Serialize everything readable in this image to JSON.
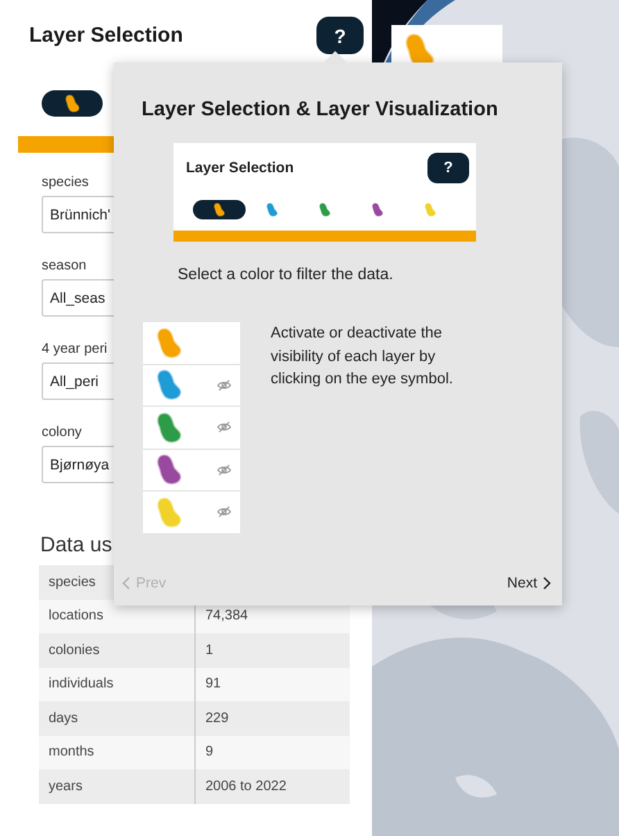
{
  "panel": {
    "title": "Layer Selection",
    "help": "?",
    "chips": [
      {
        "color": "#f5a300",
        "selected": true
      }
    ],
    "filters": [
      {
        "label": "species",
        "value": "Brünnich'"
      },
      {
        "label": "season",
        "value": "All_seas"
      },
      {
        "label": "4 year peri",
        "value": "All_peri"
      },
      {
        "label": "colony",
        "value": "Bjørnøya"
      }
    ],
    "summary": {
      "title": "Data us",
      "rows": [
        {
          "label": "species"
        },
        {
          "label": "locations",
          "value": "74,384"
        },
        {
          "label": "colonies",
          "value": "1"
        },
        {
          "label": "individuals",
          "value": "91"
        },
        {
          "label": "days",
          "value": "229"
        },
        {
          "label": "months",
          "value": "9"
        },
        {
          "label": "years",
          "value": "2006 to 2022"
        }
      ]
    }
  },
  "map": {
    "legend": [
      {
        "color": "#f5a300"
      }
    ]
  },
  "tour": {
    "title": "Layer Selection & Layer Visualization",
    "preview": {
      "title": "Layer Selection",
      "help": "?",
      "chips": [
        {
          "color": "#f5a300",
          "selected": true
        },
        {
          "color": "#1f9bd6",
          "selected": false
        },
        {
          "color": "#2e9b48",
          "selected": false
        },
        {
          "color": "#9a4a9e",
          "selected": false
        },
        {
          "color": "#f0d22a",
          "selected": false
        }
      ]
    },
    "caption": "Select a color to filter the data.",
    "layers": [
      {
        "color": "#f5a300",
        "visible": true
      },
      {
        "color": "#1f9bd6",
        "visible": false
      },
      {
        "color": "#2e9b48",
        "visible": false
      },
      {
        "color": "#9a4a9e",
        "visible": false
      },
      {
        "color": "#f0d22a",
        "visible": false
      }
    ],
    "description": "Activate or deactivate the visibility of each layer by clicking on the eye symbol.",
    "prev": {
      "label": "Prev",
      "disabled": true
    },
    "next": {
      "label": "Next",
      "disabled": false
    }
  }
}
